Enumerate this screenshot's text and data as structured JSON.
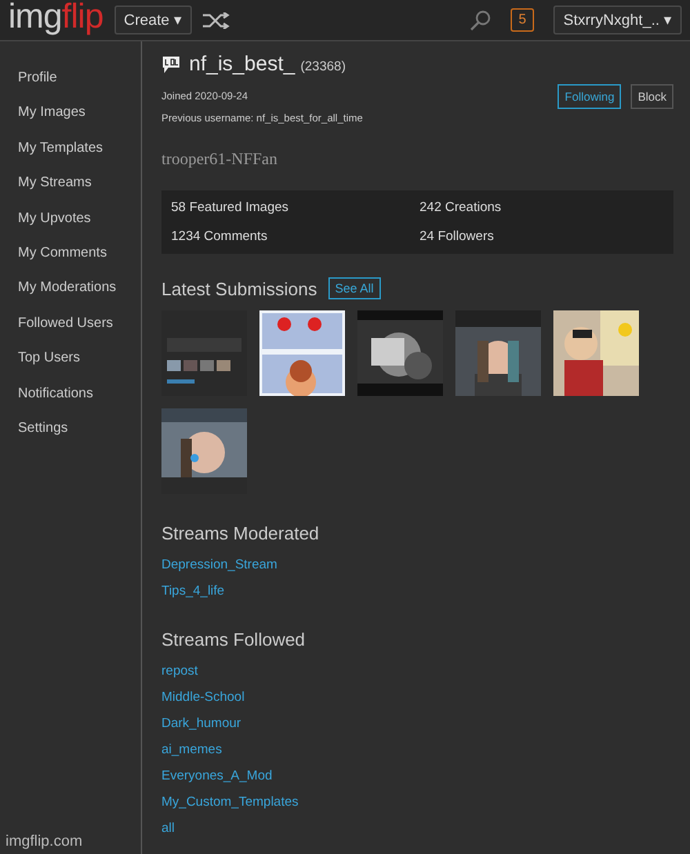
{
  "header": {
    "logo_left": "img",
    "logo_right": "flip",
    "create_button": "Create ▾",
    "notification_count": "5",
    "user_menu": "StxrryNxght_.. ▾"
  },
  "sidebar": {
    "items": [
      {
        "label": "Profile"
      },
      {
        "label": "My Images"
      },
      {
        "label": "My Templates"
      },
      {
        "label": "My Streams"
      },
      {
        "label": "My Upvotes"
      },
      {
        "label": "My Comments"
      },
      {
        "label": "My Moderations"
      },
      {
        "label": "Followed Users"
      },
      {
        "label": "Top Users"
      },
      {
        "label": "Notifications"
      },
      {
        "label": "Settings"
      }
    ],
    "footer": "imgflip.com"
  },
  "profile": {
    "username": "nf_is_best_",
    "points": "(23368)",
    "joined": "Joined 2020-09-24",
    "previous_username": "Previous username: nf_is_best_for_all_time",
    "following_button": {
      "label": "Following",
      "active": true
    },
    "block_button": "Block",
    "bio": "trooper61-NFFan"
  },
  "stats": [
    "58 Featured Images",
    "242 Creations",
    "1234 Comments",
    "24 Followers"
  ],
  "latest_submissions": {
    "title": "Latest Submissions",
    "see_all": "See All"
  },
  "streams_moderated": {
    "title": "Streams Moderated",
    "links": [
      "Depression_Stream",
      "Tips_4_life"
    ]
  },
  "streams_followed": {
    "title": "Streams Followed",
    "links": [
      "repost",
      "Middle-School",
      "Dark_humour",
      "ai_memes",
      "Everyones_A_Mod",
      "My_Custom_Templates",
      "all"
    ]
  }
}
